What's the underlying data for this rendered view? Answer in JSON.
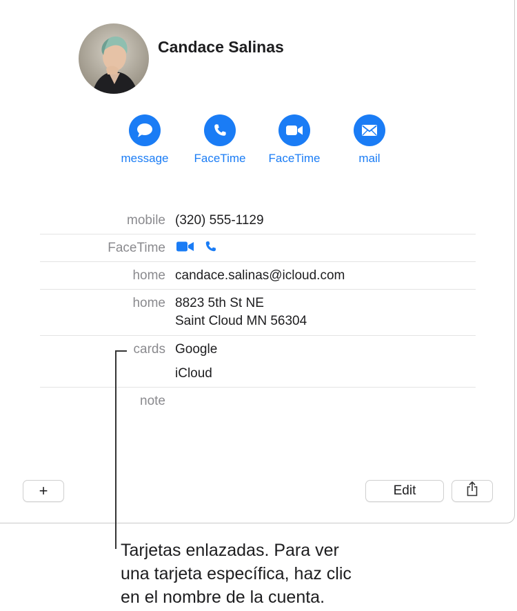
{
  "contact": {
    "name": "Candace Salinas"
  },
  "actions": [
    {
      "label": "message",
      "icon": "message-bubble-icon"
    },
    {
      "label": "FaceTime",
      "icon": "phone-icon"
    },
    {
      "label": "FaceTime",
      "icon": "video-camera-icon"
    },
    {
      "label": "mail",
      "icon": "envelope-icon"
    }
  ],
  "fields": {
    "mobile_label": "mobile",
    "mobile_value": "(320) 555-1129",
    "facetime_label": "FaceTime",
    "email_label": "home",
    "email_value": "candace.salinas@icloud.com",
    "address_label": "home",
    "address_line1": "8823 5th St NE",
    "address_line2": "Saint Cloud MN 56304",
    "cards_label": "cards",
    "card_1": "Google",
    "card_2": "iCloud",
    "note_label": "note"
  },
  "toolbar": {
    "add_label": "+",
    "edit_label": "Edit"
  },
  "callout": {
    "line1": "Tarjetas enlazadas. Para ver",
    "line2": "una tarjeta específica, haz clic",
    "line3": "en el nombre de la cuenta."
  },
  "colors": {
    "accent": "#1a7cf5",
    "label_gray": "#8a8a8e"
  }
}
